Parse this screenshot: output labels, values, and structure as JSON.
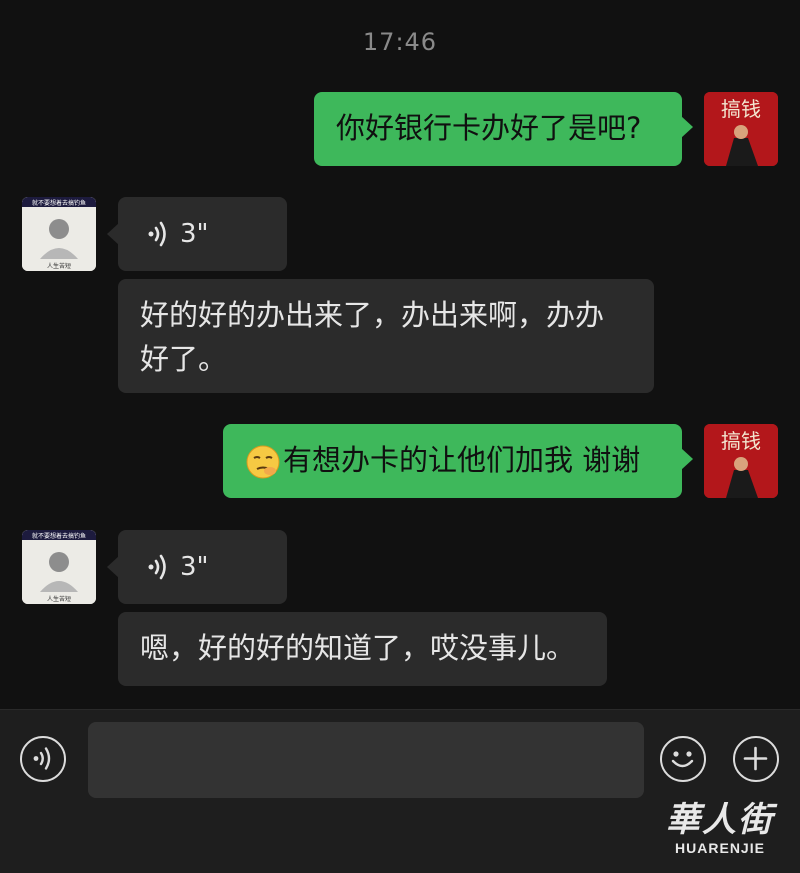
{
  "chat": {
    "timestamp": "17:46",
    "messages": [
      {
        "side": "right",
        "type": "text",
        "text": "你好银行卡办好了是吧?"
      },
      {
        "side": "left",
        "type": "voice",
        "duration": "3\""
      },
      {
        "side": "left",
        "type": "text",
        "text": "好的好的办出来了，办出来啊，办办好了。"
      },
      {
        "side": "right",
        "type": "text",
        "emoji": "smirk-hand-emoji",
        "text": "有想办卡的让他们加我 谢谢"
      },
      {
        "side": "left",
        "type": "voice",
        "duration": "3\""
      },
      {
        "side": "left",
        "type": "text",
        "text": "嗯，好的好的知道了，哎没事儿。"
      }
    ],
    "my_avatar": {
      "text": "搞钱",
      "color": "#b3171b"
    },
    "their_avatar": {
      "caption_top": "就不要想着去搞钓鱼",
      "caption_bottom": "人生苦短"
    }
  },
  "input_bar": {
    "voice_button": "voice-toggle-icon",
    "emoji_button": "emoji-face-icon",
    "more_button": "plus-icon",
    "input_value": ""
  },
  "watermark": {
    "cn": "華人街",
    "en": "HUARENJIE"
  },
  "colors": {
    "green": "#3eb85b",
    "bubble_dark": "#2b2b2b",
    "background": "#111111"
  }
}
